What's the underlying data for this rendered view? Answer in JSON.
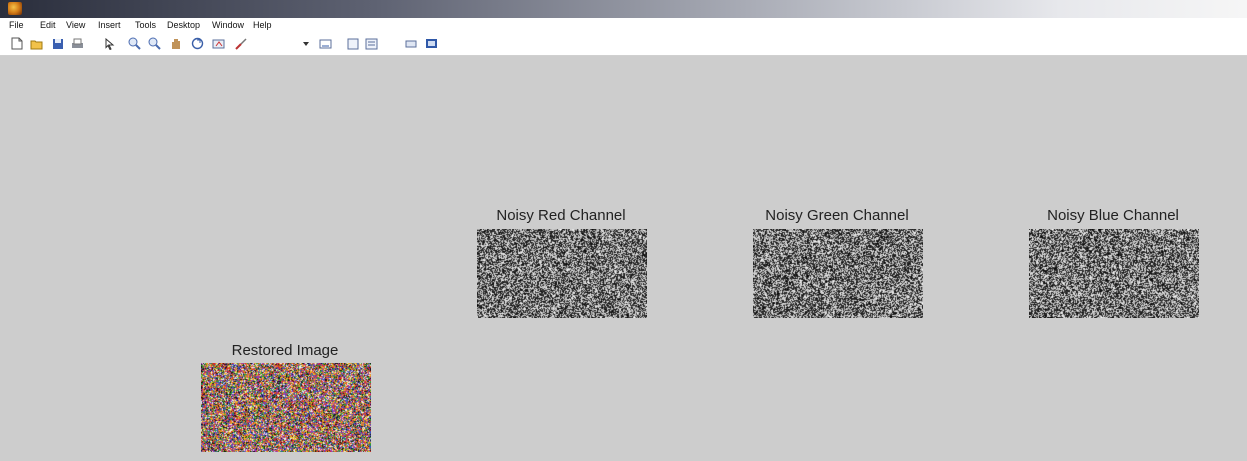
{
  "menu": [
    "File",
    "Edit",
    "View",
    "Insert",
    "Tools",
    "Desktop",
    "Window",
    "Help"
  ],
  "toolbar_icons": [
    "new-figure-icon",
    "open-file-icon",
    "save-icon",
    "print-icon",
    "edit-plot-icon",
    "zoom-in-icon",
    "zoom-out-icon",
    "pan-icon",
    "rotate-3d-icon",
    "data-cursor-icon",
    "brush-icon",
    "link-plot-icon",
    "colorbar-icon",
    "legend-icon",
    "hide-plot-tools-icon",
    "show-plot-tools-icon"
  ],
  "axes": [
    {
      "title": "Noisy Red Channel",
      "kind": "grayscale-noise"
    },
    {
      "title": "Noisy Green Channel",
      "kind": "grayscale-noise"
    },
    {
      "title": "Noisy Blue Channel",
      "kind": "grayscale-noise"
    },
    {
      "title": "Restored Image",
      "kind": "color-noise"
    }
  ],
  "colors": {
    "figure_background": "#cdcdcd",
    "titlebar_dark": "#2a2e3c",
    "titlebar_light": "#f6f6f6"
  }
}
